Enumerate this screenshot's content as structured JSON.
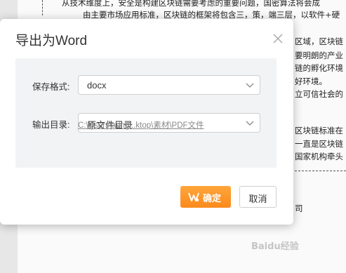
{
  "document": {
    "lines": [
      "从技术维度上，安全是构建区块链需要考虑的重要问题，国密算法将会成",
      "由主要市场应用标准，区块链的框架将包含三，策，端三层，以软件+硬",
      "区域，区块链",
      "要明朗的产业",
      "链的孵化环境",
      "好环境。",
      "立可信社会的",
      "区块链标准在",
      "一直是区块链",
      "国家机构牵头",
      "司"
    ],
    "watermark": "Baidu经验"
  },
  "dialog": {
    "title": "导出为Word",
    "format_label": "保存格式:",
    "format_value": "docx",
    "output_label": "输出目录:",
    "output_value": "原文件目录",
    "path_text": "C:\\Users\\admi...ktop\\素材\\PDF文件",
    "ok_label": "确定",
    "cancel_label": "取消"
  },
  "colors": {
    "accent": "#fb8a1c",
    "panel_bg": "#f2f3f5",
    "link_gray": "#888888"
  }
}
